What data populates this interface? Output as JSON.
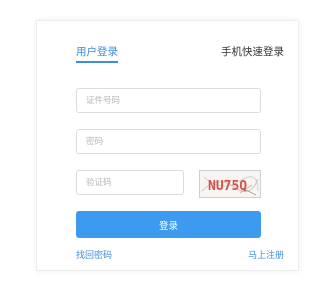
{
  "tabs": {
    "user_login": "用户登录",
    "phone_login": "手机快速登录"
  },
  "form": {
    "id_placeholder": "证件号码",
    "password_placeholder": "密码",
    "code_placeholder": "验证码",
    "captcha_text": "NU75Q",
    "login_label": "登录"
  },
  "links": {
    "forgot_password": "找回密码",
    "register": "马上注册"
  },
  "colors": {
    "accent": "#3d8ed8",
    "button": "#3d9bef",
    "captcha_text": "#d9504a"
  }
}
